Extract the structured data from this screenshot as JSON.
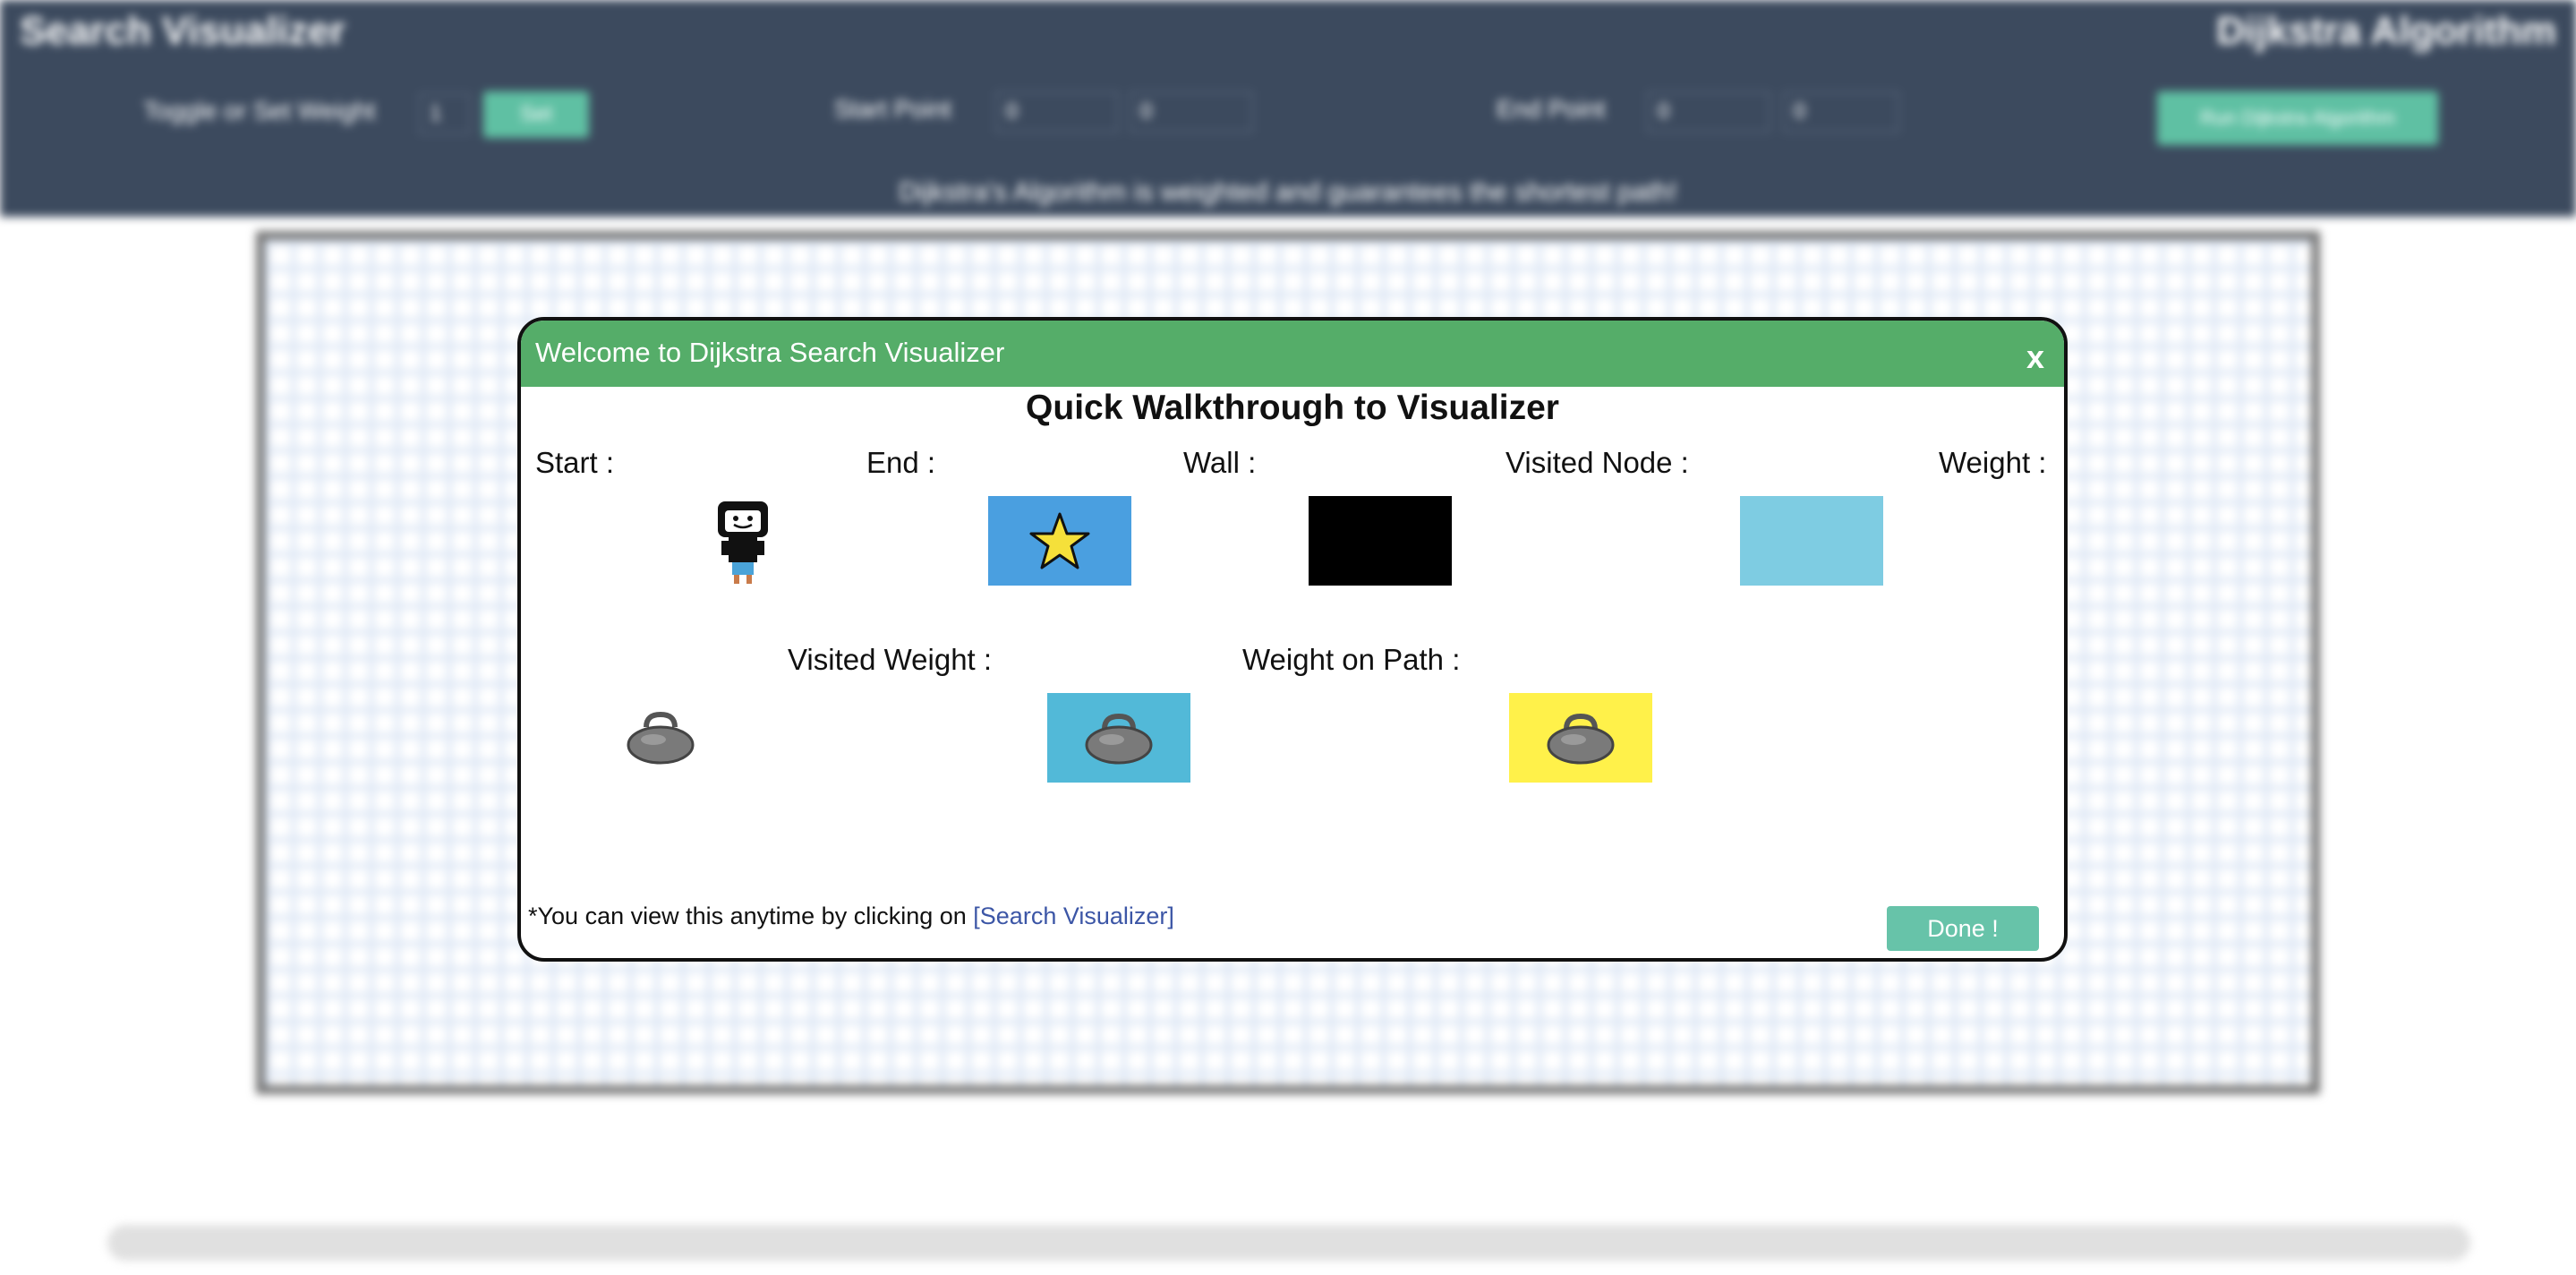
{
  "header": {
    "app_title": "Search Visualizer",
    "algorithm_title": "Dijkstra Algorithm",
    "weight_label": "Toggle or Set Weight",
    "weight_value": "1",
    "weight_button": "Set",
    "start_label": "Start Point",
    "start_row": "0",
    "start_col": "0",
    "end_label": "End Point",
    "end_row": "0",
    "end_col": "0",
    "run_button": "Run Dijkstra Algorithm",
    "tagline": "Dijkstra's Algorithm is weighted and guarantees the shortest path!"
  },
  "modal": {
    "title": "Welcome to Dijkstra Search Visualizer",
    "close_label": "x",
    "heading": "Quick Walkthrough to Visualizer",
    "legend": {
      "start": "Start :",
      "end": "End :",
      "wall": "Wall :",
      "visited_node": "Visited Node :",
      "weight": "Weight :",
      "visited_weight": "Visited Weight :",
      "weight_on_path": "Weight on Path :"
    },
    "footnote": "*You can view this anytime by clicking on",
    "footnote_link": "[Search Visualizer]",
    "done_button": "Done !"
  },
  "colors": {
    "header_bg": "#3c4a5e",
    "modal_header_bg": "#55ad69",
    "button_accent": "#67c3a9",
    "end_swatch": "#4a9fe0",
    "wall_swatch": "#000000",
    "visited_node_swatch": "#7ecce2",
    "visited_weight_swatch": "#52b9d8",
    "weight_on_path_swatch": "#fff14a",
    "link": "#3c56a6"
  },
  "icons": {
    "start": "robot-character-icon",
    "end": "star-icon",
    "weight": "kettlebell-icon"
  }
}
